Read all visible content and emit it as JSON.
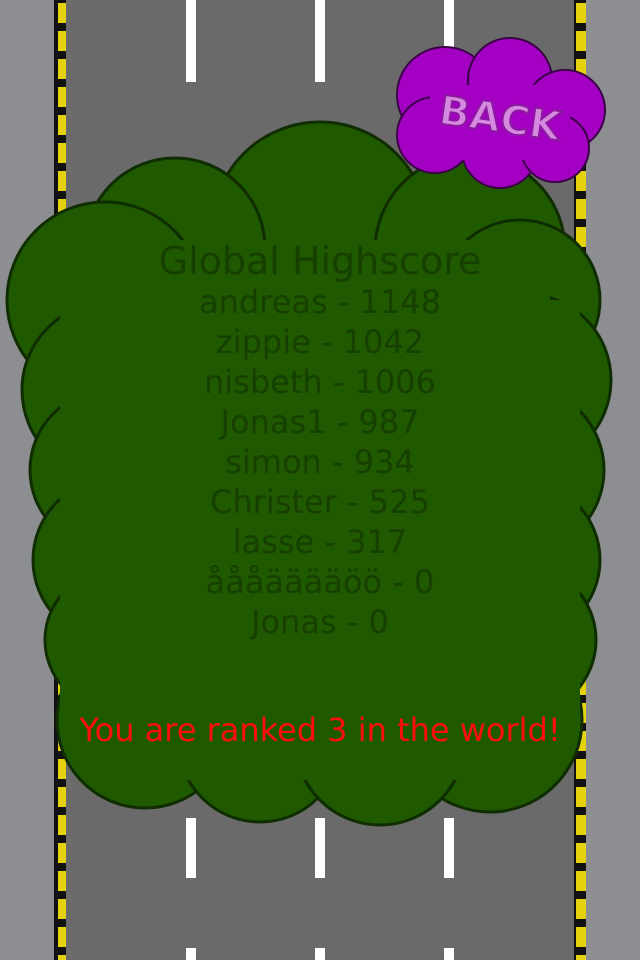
{
  "colors": {
    "road": "#6a6a6b",
    "shoulder": "#8d8e91",
    "lane_marking": "#ffffff",
    "hazard_yellow": "#e6d20c",
    "bush_fill": "#1f5a00",
    "bush_outline": "#0f2d00",
    "text_dark": "#163f00",
    "rank_text": "#ff0d0d",
    "back_fill": "#a400c4",
    "back_text": "#d58adf"
  },
  "back_button": {
    "label": "BACK"
  },
  "highscore": {
    "title": "Global Highscore",
    "entries": [
      "andreas - 1148",
      "zippie - 1042",
      "nisbeth - 1006",
      "Jonas1 - 987",
      "simon - 934",
      "Christer - 525",
      "lasse - 317",
      "åååääääöö - 0",
      "Jonas - 0"
    ]
  },
  "rank_message": "You are ranked 3 in the world!"
}
